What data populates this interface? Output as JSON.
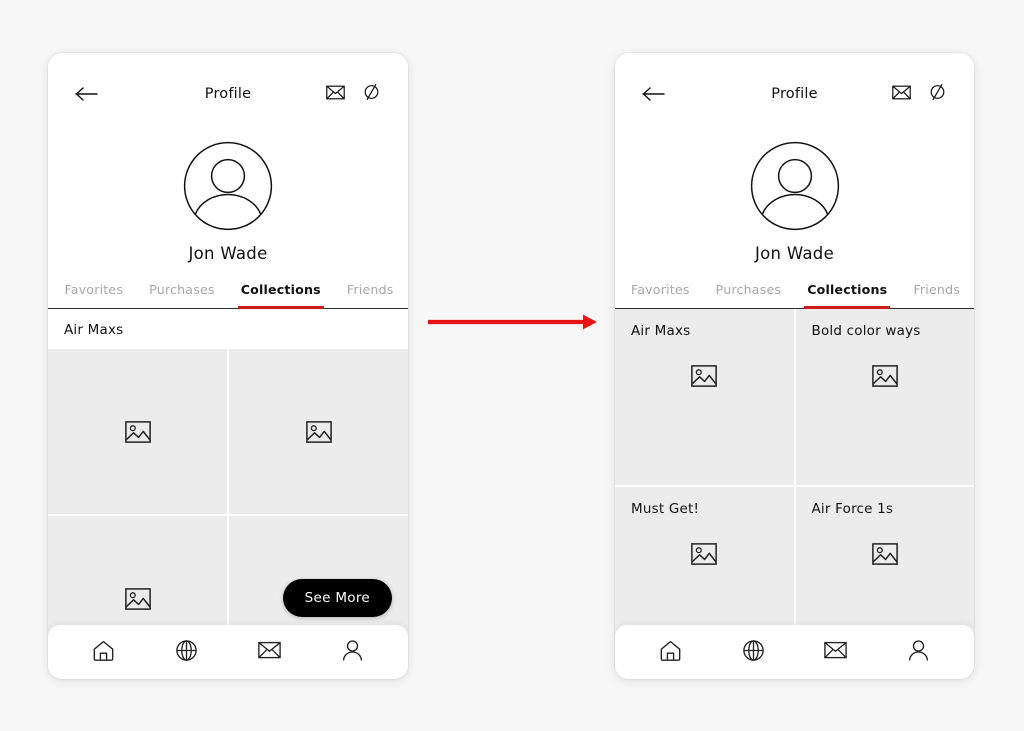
{
  "accent": {
    "red": "#cf1a1a",
    "arrow_red": "#e81414",
    "tile_bg": "#ececec",
    "pill_bg": "#000000",
    "page_bg": "#f7f7f7"
  },
  "flow": {
    "arrow_name": "red-right-arrow",
    "direction": "right"
  },
  "screens": [
    {
      "id": "before",
      "topbar": {
        "back_icon": "back-arrow-icon",
        "title": "Profile",
        "actions": [
          {
            "icon": "envelope-icon",
            "label": "Messages"
          },
          {
            "icon": "slashed-circle-icon",
            "label": "Block"
          }
        ]
      },
      "profile": {
        "avatar_icon": "user-avatar-icon",
        "name": "Jon Wade"
      },
      "tabs": [
        {
          "label": "Favorites",
          "active": false
        },
        {
          "label": "Purchases",
          "active": false
        },
        {
          "label": "Collections",
          "active": true
        },
        {
          "label": "Friends",
          "active": false
        }
      ],
      "collections": {
        "section_title": "Air Maxs",
        "tiles": [
          {
            "label": "",
            "image_icon": "image-placeholder-icon"
          },
          {
            "label": "",
            "image_icon": "image-placeholder-icon"
          },
          {
            "label": "",
            "image_icon": "image-placeholder-icon"
          },
          {
            "label": "",
            "image_icon": "image-placeholder-icon"
          }
        ]
      },
      "see_more": {
        "label": "See More",
        "visible": true
      },
      "bottomnav": [
        {
          "icon": "home-icon",
          "label": "Home"
        },
        {
          "icon": "globe-icon",
          "label": "Explore"
        },
        {
          "icon": "envelope-icon",
          "label": "Inbox"
        },
        {
          "icon": "person-icon",
          "label": "Profile"
        }
      ]
    },
    {
      "id": "after",
      "topbar": {
        "back_icon": "back-arrow-icon",
        "title": "Profile",
        "actions": [
          {
            "icon": "envelope-icon",
            "label": "Messages"
          },
          {
            "icon": "slashed-circle-icon",
            "label": "Block"
          }
        ]
      },
      "profile": {
        "avatar_icon": "user-avatar-icon",
        "name": "Jon Wade"
      },
      "tabs": [
        {
          "label": "Favorites",
          "active": false
        },
        {
          "label": "Purchases",
          "active": false
        },
        {
          "label": "Collections",
          "active": true
        },
        {
          "label": "Friends",
          "active": false
        }
      ],
      "collections": {
        "section_title": "",
        "tiles": [
          {
            "label": "Air Maxs",
            "image_icon": "image-placeholder-icon"
          },
          {
            "label": "Bold color ways",
            "image_icon": "image-placeholder-icon"
          },
          {
            "label": "Must Get!",
            "image_icon": "image-placeholder-icon"
          },
          {
            "label": "Air Force 1s",
            "image_icon": "image-placeholder-icon"
          }
        ]
      },
      "see_more": {
        "label": "See More",
        "visible": false
      },
      "bottomnav": [
        {
          "icon": "home-icon",
          "label": "Home"
        },
        {
          "icon": "globe-icon",
          "label": "Explore"
        },
        {
          "icon": "envelope-icon",
          "label": "Inbox"
        },
        {
          "icon": "person-icon",
          "label": "Profile"
        }
      ]
    }
  ]
}
